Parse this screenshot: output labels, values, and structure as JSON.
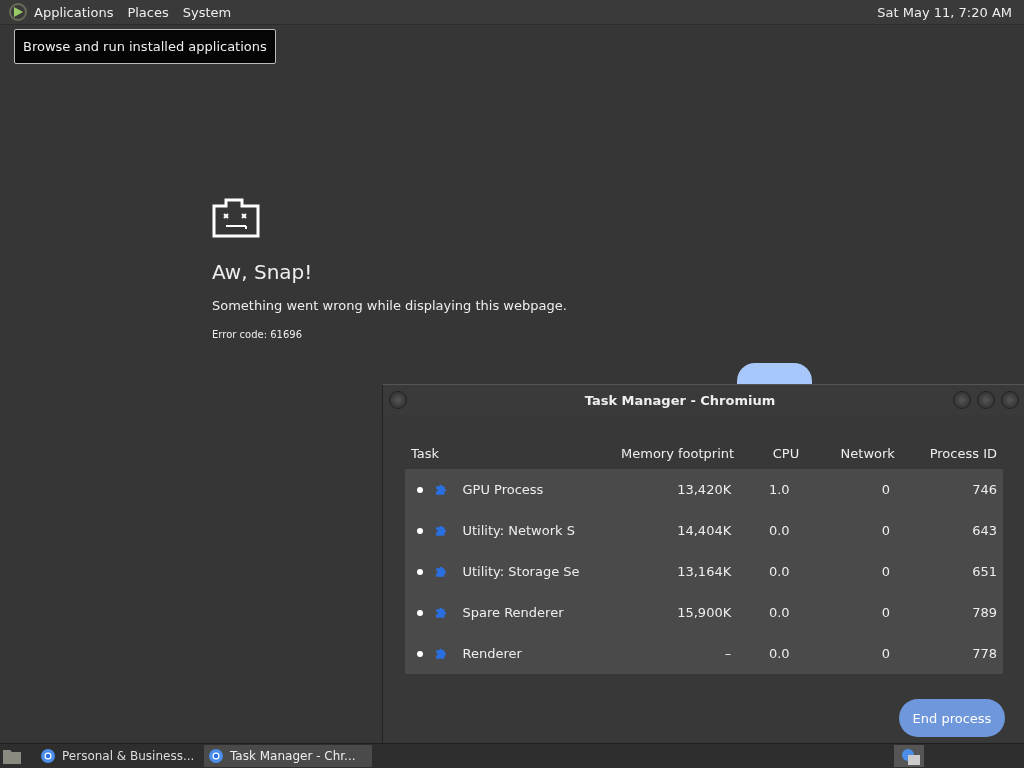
{
  "top_panel": {
    "menus": [
      "Applications",
      "Places",
      "System"
    ],
    "clock": "Sat May 11,  7:20 AM"
  },
  "tooltip": "Browse and run installed applications",
  "error_page": {
    "title": "Aw, Snap!",
    "message": "Something went wrong while displaying this webpage.",
    "code": "Error code: 61696"
  },
  "task_manager": {
    "title": "Task Manager - Chromium",
    "columns": [
      "Task",
      "Memory footprint",
      "CPU",
      "Network",
      "Process ID"
    ],
    "rows": [
      {
        "task": "GPU Process",
        "memory": "13,420K",
        "cpu": "1.0",
        "network": "0",
        "pid": "746"
      },
      {
        "task": "Utility: Network S",
        "memory": "14,404K",
        "cpu": "0.0",
        "network": "0",
        "pid": "643"
      },
      {
        "task": "Utility: Storage Se",
        "memory": "13,164K",
        "cpu": "0.0",
        "network": "0",
        "pid": "651"
      },
      {
        "task": "Spare Renderer",
        "memory": "15,900K",
        "cpu": "0.0",
        "network": "0",
        "pid": "789"
      },
      {
        "task": "Renderer",
        "memory": "–",
        "cpu": "0.0",
        "network": "0",
        "pid": "778"
      }
    ],
    "button": "End process"
  },
  "taskbar": {
    "items": [
      {
        "label": "Personal & Business...",
        "selected": false
      },
      {
        "label": "Task Manager - Chr...",
        "selected": true
      }
    ]
  }
}
